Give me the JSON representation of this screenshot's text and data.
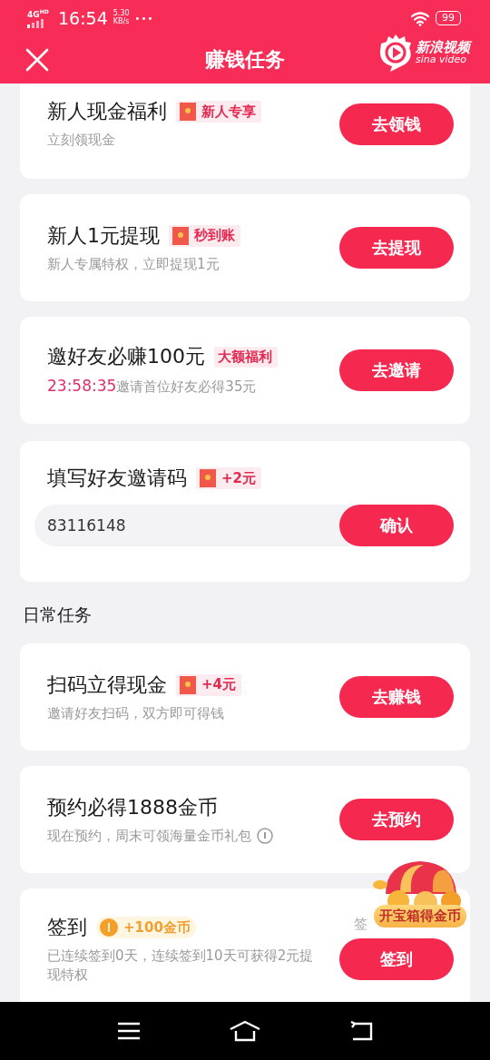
{
  "status_bar": {
    "network": "4G",
    "network_sup": "HD",
    "time": "16:54",
    "speed": "5.30",
    "speed_unit": "KB/s",
    "more": "•••",
    "battery": "99"
  },
  "header": {
    "title": "赚钱任务",
    "logo_name": "新浪视频",
    "logo_sub": "sina video"
  },
  "top_tasks": [
    {
      "kind": "task",
      "title": "新人现金福利",
      "tag": {
        "kind": "packet",
        "label": "新人专享"
      },
      "subtitle": "立刻领现金",
      "button": "去领钱"
    },
    {
      "kind": "task",
      "title": "新人1元提现",
      "tag": {
        "kind": "packet",
        "label": "秒到账"
      },
      "subtitle": "新人专属特权，立即提现1元",
      "button": "去提现"
    },
    {
      "kind": "task",
      "title": "邀好友必赚100元",
      "tag": {
        "kind": "plain",
        "label": "大额福利"
      },
      "timer": "23:58:35",
      "subtitle": "邀请首位好友必得35元",
      "button": "去邀请"
    },
    {
      "kind": "invite_code",
      "title": "填写好友邀请码",
      "tag": {
        "kind": "packet",
        "label": "+2元"
      },
      "value": "83116148",
      "button": "确认"
    }
  ],
  "daily_section": {
    "title": "日常任务"
  },
  "daily_tasks": [
    {
      "kind": "task",
      "title": "扫码立得现金",
      "tag": {
        "kind": "packet",
        "label": "+4元"
      },
      "subtitle": "邀请好友扫码，双方即可得钱",
      "button": "去赚钱"
    },
    {
      "kind": "task",
      "title": "预约必得1888金币",
      "subtitle": "现在预约，周末可领海量金币礼包",
      "info": true,
      "button": "去预约"
    },
    {
      "kind": "task",
      "title": "签到",
      "tag": {
        "kind": "coin",
        "label": "+100金币"
      },
      "subtitle": "已连续签到0天，连续签到10天可获得2元提现特权",
      "note": "签",
      "button": "签到"
    }
  ],
  "floating_badge": {
    "label": "开宝箱得金币"
  }
}
